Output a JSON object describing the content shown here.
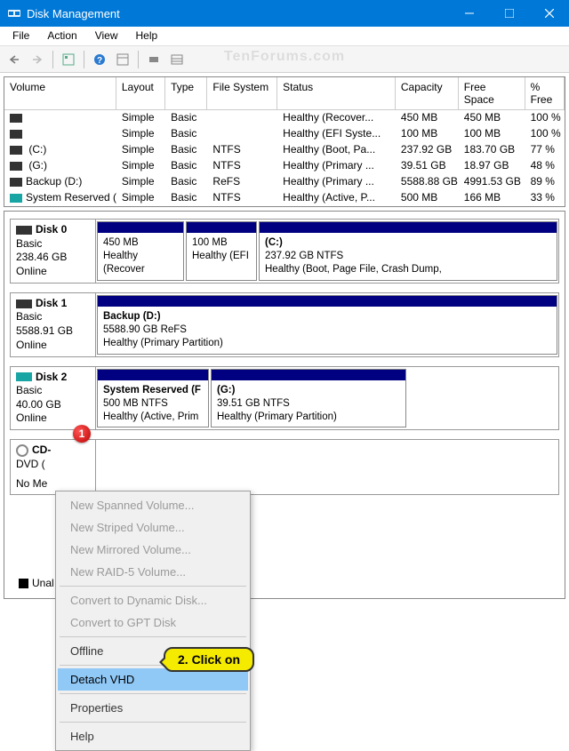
{
  "titlebar": {
    "title": "Disk Management"
  },
  "menu": {
    "file": "File",
    "action": "Action",
    "view": "View",
    "help": "Help"
  },
  "watermark": "TenForums.com",
  "columns": {
    "volume": "Volume",
    "layout": "Layout",
    "type": "Type",
    "fs": "File System",
    "status": "Status",
    "capacity": "Capacity",
    "free": "Free Space",
    "pfree": "% Free"
  },
  "volumes": [
    {
      "iconClass": "",
      "name": "",
      "layout": "Simple",
      "type": "Basic",
      "fs": "",
      "status": "Healthy (Recover...",
      "capacity": "450 MB",
      "free": "450 MB",
      "pfree": "100 %"
    },
    {
      "iconClass": "",
      "name": "",
      "layout": "Simple",
      "type": "Basic",
      "fs": "",
      "status": "Healthy (EFI Syste...",
      "capacity": "100 MB",
      "free": "100 MB",
      "pfree": "100 %"
    },
    {
      "iconClass": "",
      "name": " (C:)",
      "layout": "Simple",
      "type": "Basic",
      "fs": "NTFS",
      "status": "Healthy (Boot, Pa...",
      "capacity": "237.92 GB",
      "free": "183.70 GB",
      "pfree": "77 %"
    },
    {
      "iconClass": "",
      "name": " (G:)",
      "layout": "Simple",
      "type": "Basic",
      "fs": "NTFS",
      "status": "Healthy (Primary ...",
      "capacity": "39.51 GB",
      "free": "18.97 GB",
      "pfree": "48 %"
    },
    {
      "iconClass": "",
      "name": "Backup (D:)",
      "layout": "Simple",
      "type": "Basic",
      "fs": "ReFS",
      "status": "Healthy (Primary ...",
      "capacity": "5588.88 GB",
      "free": "4991.53 GB",
      "pfree": "89 %"
    },
    {
      "iconClass": "teal",
      "name": "System Reserved (...",
      "layout": "Simple",
      "type": "Basic",
      "fs": "NTFS",
      "status": "Healthy (Active, P...",
      "capacity": "500 MB",
      "free": "166 MB",
      "pfree": "33 %"
    }
  ],
  "disks": {
    "d0": {
      "title": "Disk 0",
      "type": "Basic",
      "size": "238.46 GB",
      "state": "Online",
      "p0": {
        "name": "",
        "size": "450 MB",
        "status": "Healthy (Recover"
      },
      "p1": {
        "name": "",
        "size": "100 MB",
        "status": "Healthy (EFI"
      },
      "p2": {
        "name": "(C:)",
        "size": "237.92 GB NTFS",
        "status": "Healthy (Boot, Page File, Crash Dump,"
      }
    },
    "d1": {
      "title": "Disk 1",
      "type": "Basic",
      "size": "5588.91 GB",
      "state": "Online",
      "p0": {
        "name": "Backup  (D:)",
        "size": "5588.90 GB ReFS",
        "status": "Healthy (Primary Partition)"
      }
    },
    "d2": {
      "title": "Disk 2",
      "type": "Basic",
      "size": "40.00 GB",
      "state": "Online",
      "p0": {
        "name": "System Reserved  (F",
        "size": "500 MB NTFS",
        "status": "Healthy (Active, Prim"
      },
      "p1": {
        "name": "(G:)",
        "size": "39.51 GB NTFS",
        "status": "Healthy (Primary Partition)"
      }
    },
    "cd": {
      "title": "CD-",
      "type": "DVD (",
      "nomedia": "No Me"
    }
  },
  "contextMenu": {
    "newSpanned": "New Spanned Volume...",
    "newStriped": "New Striped Volume...",
    "newMirrored": "New Mirrored Volume...",
    "newRaid5": "New RAID-5 Volume...",
    "convertDynamic": "Convert to Dynamic Disk...",
    "convertGpt": "Convert to GPT Disk",
    "offline": "Offline",
    "detachVhd": "Detach VHD",
    "properties": "Properties",
    "help": "Help"
  },
  "annotations": {
    "step1": "1",
    "step2": "2. Click on"
  },
  "footer": {
    "unallocated": "Unal"
  }
}
